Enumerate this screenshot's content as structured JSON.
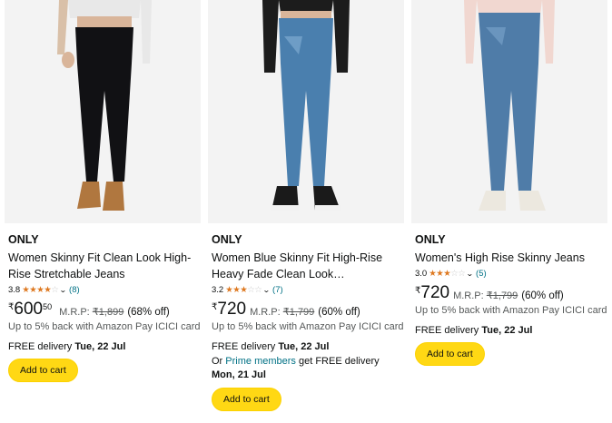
{
  "products": [
    {
      "brand": "ONLY",
      "title": "Women Skinny Fit Clean Look High-Rise Stretchable Jeans",
      "rating_score": "3.8",
      "stars_full": "★★★★",
      "stars_empty": "☆",
      "review_count": "(8)",
      "currency": "₹",
      "price_whole": "600",
      "price_fraction": "50",
      "mrp_label": "M.R.P:",
      "mrp_value": "₹1,899",
      "discount": "(68% off)",
      "cashback": "Up to 5% back with Amazon Pay ICICI card",
      "delivery_prefix": "FREE delivery",
      "delivery_date": "Tue, 22 Jul",
      "add_to_cart": "Add to cart",
      "jeans_color": "#111114"
    },
    {
      "brand": "ONLY",
      "title": "Women Blue Skinny Fit High-Rise Heavy Fade Clean Look Stretchable…",
      "rating_score": "3.2",
      "stars_full": "★★★",
      "stars_empty": "☆☆",
      "review_count": "(7)",
      "currency": "₹",
      "price_whole": "720",
      "price_fraction": "",
      "mrp_label": "M.R.P:",
      "mrp_value": "₹1,799",
      "discount": "(60% off)",
      "cashback": "Up to 5% back with Amazon Pay ICICI card",
      "delivery_prefix": "FREE delivery",
      "delivery_date": "Tue, 22 Jul",
      "prime_or": "Or",
      "prime_link": "Prime members",
      "prime_mid": "get FREE delivery",
      "prime_date": "Mon, 21 Jul",
      "add_to_cart": "Add to cart",
      "jeans_color": "#4a7fae"
    },
    {
      "brand": "ONLY",
      "title": "Women's High Rise Skinny Jeans",
      "rating_score": "3.0",
      "stars_full": "★★★",
      "stars_empty": "☆☆",
      "review_count": "(5)",
      "currency": "₹",
      "price_whole": "720",
      "price_fraction": "",
      "mrp_label": "M.R.P:",
      "mrp_value": "₹1,799",
      "discount": "(60% off)",
      "cashback": "Up to 5% back with Amazon Pay ICICI card",
      "delivery_prefix": "FREE delivery",
      "delivery_date": "Tue, 22 Jul",
      "add_to_cart": "Add to cart",
      "jeans_color": "#4f7ca8"
    }
  ],
  "colors": {
    "button_yellow": "#ffd814",
    "star_orange": "#de7921",
    "link_teal": "#007185",
    "image_bg": "#f3f3f3"
  }
}
